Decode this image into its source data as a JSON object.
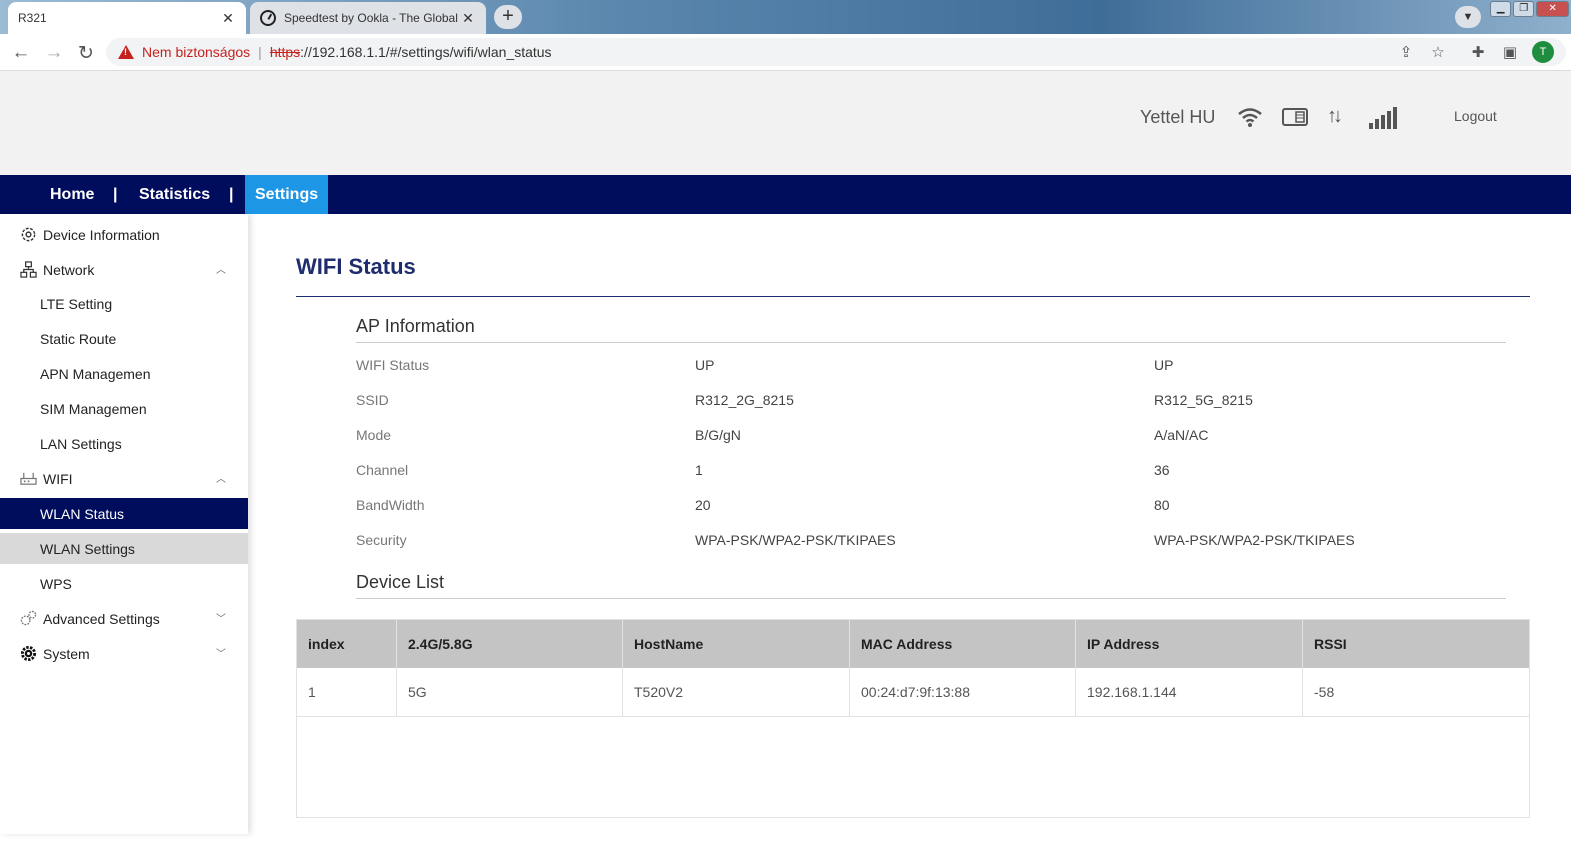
{
  "browser": {
    "tabs": [
      {
        "title": "R321",
        "active": true
      },
      {
        "title": "Speedtest by Ookla - The Global",
        "active": false
      }
    ],
    "new_tab": "+",
    "insecure_label": "Nem biztonságos",
    "url_scheme": "https",
    "url_rest": "://192.168.1.1/#/settings/wifi/wlan_status",
    "profile_initial": "T"
  },
  "header": {
    "carrier": "Yettel HU",
    "logout": "Logout"
  },
  "mainnav": {
    "home": "Home",
    "statistics": "Statistics",
    "settings": "Settings",
    "separator": "|"
  },
  "sidebar": {
    "device_information": "Device Information",
    "network": "Network",
    "lte_setting": "LTE Setting",
    "static_route": "Static Route",
    "apn_management": "APN Managemen",
    "sim_management": "SIM Managemen",
    "lan_settings": "LAN Settings",
    "wifi": "WIFI",
    "wlan_status": "WLAN Status",
    "wlan_settings": "WLAN Settings",
    "wps": "WPS",
    "advanced_settings": "Advanced Settings",
    "system": "System"
  },
  "main": {
    "title": "WIFI Status",
    "ap_section": "AP Information",
    "ap_rows": [
      {
        "label": "WIFI Status",
        "v1": "UP",
        "v2": "UP"
      },
      {
        "label": "SSID",
        "v1": "R312_2G_8215",
        "v2": "R312_5G_8215"
      },
      {
        "label": "Mode",
        "v1": "B/G/gN",
        "v2": "A/aN/AC"
      },
      {
        "label": "Channel",
        "v1": "1",
        "v2": "36"
      },
      {
        "label": "BandWidth",
        "v1": "20",
        "v2": "80"
      },
      {
        "label": "Security",
        "v1": "WPA-PSK/WPA2-PSK/TKIPAES",
        "v2": "WPA-PSK/WPA2-PSK/TKIPAES"
      }
    ],
    "device_section": "Device List",
    "device_table": {
      "headers": [
        "index",
        "2.4G/5.8G",
        "HostName",
        "MAC Address",
        "IP Address",
        "RSSI"
      ],
      "rows": [
        [
          "1",
          "5G",
          "T520V2",
          "00:24:d7:9f:13:88",
          "192.168.1.144",
          "-58"
        ]
      ]
    }
  },
  "colors": {
    "nav_bg": "#000c5c",
    "nav_active": "#1e96e6",
    "title": "#1f2d6e",
    "table_header": "#c4c4c4"
  }
}
